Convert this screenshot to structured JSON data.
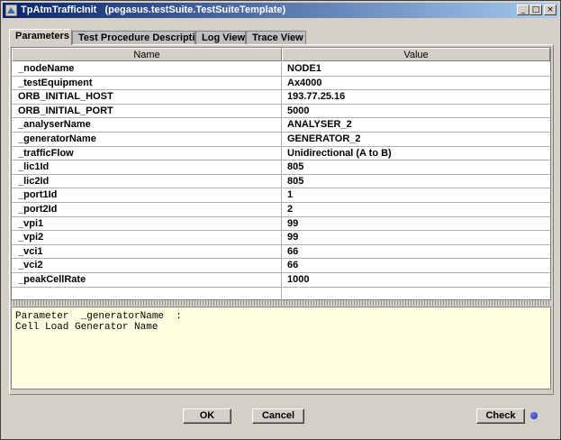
{
  "window": {
    "title": "TpAtmTrafficInit   (pegasus.testSuite.TestSuiteTemplate)",
    "controls": {
      "minimize": "_",
      "maximize": "□",
      "close": "×"
    }
  },
  "tabs": [
    {
      "label": "Parameters",
      "active": true
    },
    {
      "label": "Test Procedure Description",
      "active": false
    },
    {
      "label": "Log View",
      "active": false
    },
    {
      "label": "Trace View",
      "active": false
    }
  ],
  "table": {
    "headers": {
      "name": "Name",
      "value": "Value"
    },
    "rows": [
      {
        "name": "_nodeName",
        "value": "NODE1"
      },
      {
        "name": "_testEquipment",
        "value": "Ax4000"
      },
      {
        "name": "ORB_INITIAL_HOST",
        "value": "193.77.25.16"
      },
      {
        "name": "ORB_INITIAL_PORT",
        "value": "5000"
      },
      {
        "name": "_analyserName",
        "value": "ANALYSER_2"
      },
      {
        "name": "_generatorName",
        "value": "GENERATOR_2"
      },
      {
        "name": "_trafficFlow",
        "value": "Unidirectional (A to B)"
      },
      {
        "name": "_lic1Id",
        "value": "805"
      },
      {
        "name": "_lic2Id",
        "value": "805"
      },
      {
        "name": "_port1Id",
        "value": "1"
      },
      {
        "name": "_port2Id",
        "value": "2"
      },
      {
        "name": "_vpi1",
        "value": "99"
      },
      {
        "name": "_vpi2",
        "value": "99"
      },
      {
        "name": "_vci1",
        "value": "66"
      },
      {
        "name": "_vci2",
        "value": "66"
      },
      {
        "name": "_peakCellRate",
        "value": "1000"
      }
    ]
  },
  "description": {
    "line1": "Parameter  _generatorName  :",
    "line2": "Cell Load Generator Name"
  },
  "buttons": {
    "ok": "OK",
    "cancel": "Cancel",
    "check": "Check"
  },
  "colors": {
    "titlebar_start": "#0a246a",
    "titlebar_end": "#a6caf0",
    "description_bg": "#ffffe1",
    "status_led": "#1c2a9c"
  }
}
